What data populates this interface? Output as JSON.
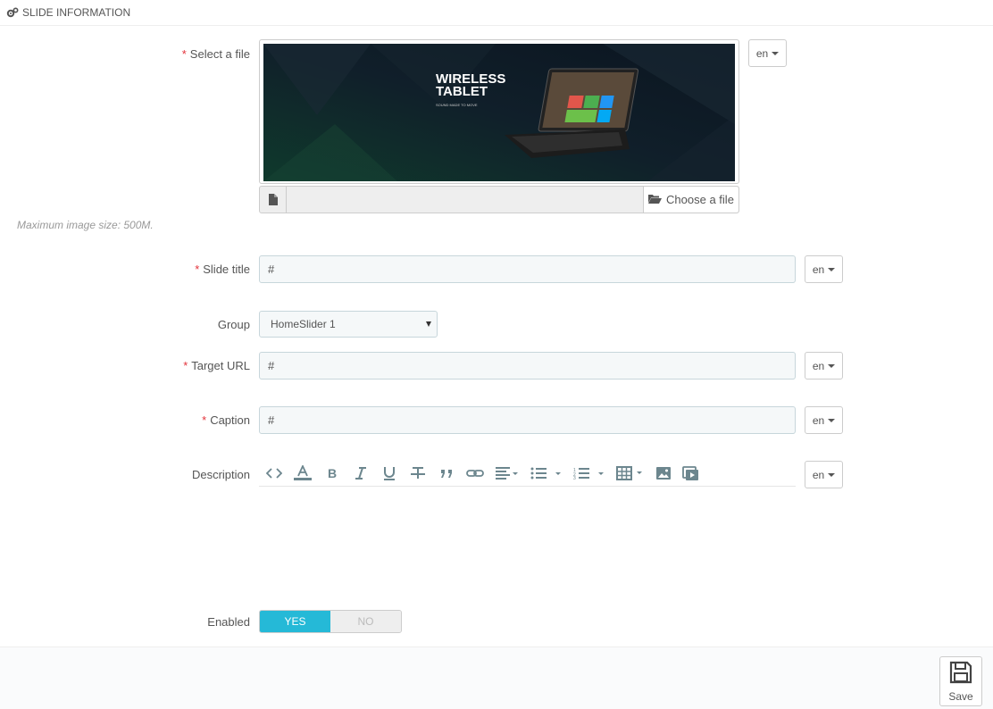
{
  "panel": {
    "title": "Slide information",
    "icon": "cogs-icon"
  },
  "fields": {
    "file": {
      "label": "Select a file",
      "lang": "en",
      "choose_label": "Choose a file",
      "help": "Maximum image size: 500M."
    },
    "banner": {
      "line1": "WIRELESS",
      "line2": "TABLET",
      "tagline": "SOUND MADE TO MOVE"
    },
    "slide_title": {
      "label": "Slide title",
      "value": "#",
      "lang": "en"
    },
    "group": {
      "label": "Group",
      "value": "HomeSlider 1"
    },
    "target_url": {
      "label": "Target URL",
      "value": "#",
      "lang": "en"
    },
    "caption": {
      "label": "Caption",
      "value": "#",
      "lang": "en"
    },
    "description": {
      "label": "Description",
      "lang": "en"
    },
    "enabled": {
      "label": "Enabled",
      "yes": "YES",
      "no": "NO"
    }
  },
  "toolbar_icons": [
    "code-icon",
    "font-color-icon",
    "bold-icon",
    "italic-icon",
    "underline-icon",
    "strikethrough-icon",
    "quote-icon",
    "link-icon",
    "align-left-icon",
    "bullet-list-icon",
    "numbered-list-icon",
    "table-icon",
    "image-icon",
    "video-icon"
  ],
  "footer": {
    "save_label": "Save"
  },
  "colors": {
    "accent": "#25b9d7",
    "required": "#e3333b"
  }
}
